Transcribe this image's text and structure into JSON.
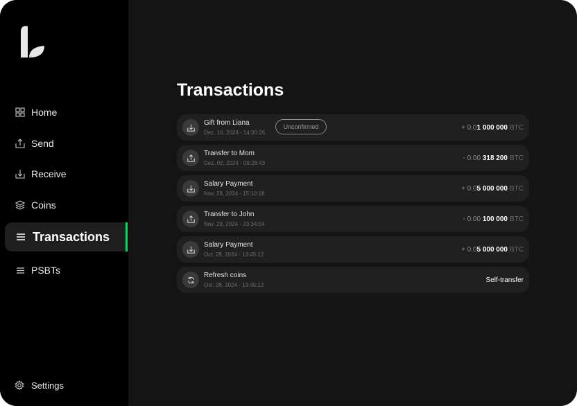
{
  "sidebar": {
    "items": [
      {
        "id": "home",
        "label": "Home",
        "icon": "grid-icon"
      },
      {
        "id": "send",
        "label": "Send",
        "icon": "send-icon"
      },
      {
        "id": "receive",
        "label": "Receive",
        "icon": "receive-icon"
      },
      {
        "id": "coins",
        "label": "Coins",
        "icon": "coins-icon"
      },
      {
        "id": "transactions",
        "label": "Transactions",
        "icon": "list-icon",
        "active": true
      },
      {
        "id": "psbts",
        "label": "PSBTs",
        "icon": "list-icon"
      }
    ],
    "settings_label": "Settings"
  },
  "main": {
    "title": "Transactions",
    "transactions": [
      {
        "label": "Gift from Liana",
        "date": "Dez. 10, 2024 - 14:30:26",
        "badge": "Unconfirmed",
        "amount_prefix": "+ 0.0",
        "amount_main": "1 000 000",
        "unit": "BTC",
        "icon": "receive-icon"
      },
      {
        "label": "Transfer to Mom",
        "date": "Dez. 02, 2024 - 09:28:43",
        "amount_prefix": "- 0.00 ",
        "amount_main": "318 200",
        "unit": "BTC",
        "icon": "send-icon"
      },
      {
        "label": "Salary Payment",
        "date": "Nov. 28, 2024 - 15:10:18",
        "amount_prefix": "+ 0.0",
        "amount_main": "5 000 000",
        "unit": "BTC",
        "icon": "receive-icon"
      },
      {
        "label": "Transfer to John",
        "date": "Nov. 28, 2024 - 23:34:04",
        "amount_prefix": "- 0.00 ",
        "amount_main": "100 000",
        "unit": "BTC",
        "icon": "send-icon"
      },
      {
        "label": "Salary Payment",
        "date": "Oct. 28, 2024 - 13:45:12",
        "amount_prefix": "+ 0.0",
        "amount_main": "5 000 000",
        "unit": "BTC",
        "icon": "receive-icon"
      },
      {
        "label": "Refresh coins",
        "date": "Oct. 28, 2024 - 13:45:12",
        "amount_text": "Self-transfer",
        "icon": "refresh-icon"
      }
    ]
  },
  "colors": {
    "accent": "#00e05a",
    "sidebar_bg": "#000000",
    "main_bg": "#141414",
    "row_bg": "#202020"
  }
}
